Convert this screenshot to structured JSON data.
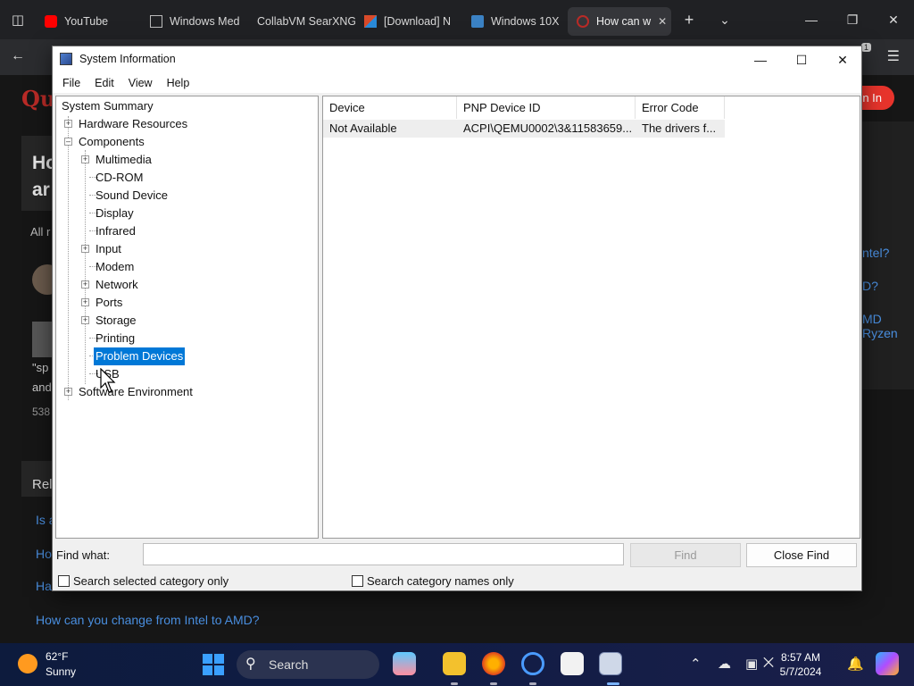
{
  "browser": {
    "tabs": [
      {
        "label": "YouTube",
        "icon": "youtube-icon",
        "color": "#ff0000"
      },
      {
        "label": "Windows Med",
        "icon": "windows-media-icon",
        "color": "#bbbbbb"
      },
      {
        "label": "CollabVM SearXNG",
        "icon": "searxng-icon",
        "color": "#3050ff"
      },
      {
        "label": "[Download] N",
        "icon": "download-icon",
        "color": "#d84a2a"
      },
      {
        "label": "Windows 10X",
        "icon": "windows-10x-icon",
        "color": "#3b82c4"
      },
      {
        "label": "How can w",
        "icon": "quora-icon",
        "color": "#b92b27"
      }
    ],
    "nav_badge": "1"
  },
  "webpage": {
    "logo": "Qu",
    "signin_label": "n In",
    "card_title_line1": "Ho",
    "card_title_line2": "ar",
    "all_text": "All r",
    "answer_line3": "\"sp",
    "answer_line4": "and",
    "views": "538",
    "related_label": "Rel",
    "related_links": [
      "Is a",
      "Ho",
      "How can you change from Intel to AMD?"
    ],
    "partial_related": "Ha",
    "side_links": [
      "ntel?",
      "D?",
      "MD Ryzen"
    ]
  },
  "window": {
    "title": "System Information",
    "menu": [
      "File",
      "Edit",
      "View",
      "Help"
    ],
    "tree": [
      {
        "label": "System Summary",
        "level": 0,
        "expander": ""
      },
      {
        "label": "Hardware Resources",
        "level": 1,
        "expander": "+"
      },
      {
        "label": "Components",
        "level": 1,
        "expander": "-"
      },
      {
        "label": "Multimedia",
        "level": 2,
        "expander": "+"
      },
      {
        "label": "CD-ROM",
        "level": 2,
        "expander": ""
      },
      {
        "label": "Sound Device",
        "level": 2,
        "expander": ""
      },
      {
        "label": "Display",
        "level": 2,
        "expander": ""
      },
      {
        "label": "Infrared",
        "level": 2,
        "expander": ""
      },
      {
        "label": "Input",
        "level": 2,
        "expander": "+"
      },
      {
        "label": "Modem",
        "level": 2,
        "expander": ""
      },
      {
        "label": "Network",
        "level": 2,
        "expander": "+"
      },
      {
        "label": "Ports",
        "level": 2,
        "expander": "+"
      },
      {
        "label": "Storage",
        "level": 2,
        "expander": "+"
      },
      {
        "label": "Printing",
        "level": 2,
        "expander": ""
      },
      {
        "label": "Problem Devices",
        "level": 2,
        "expander": "",
        "selected": true
      },
      {
        "label": "USB",
        "level": 2,
        "expander": ""
      },
      {
        "label": "Software Environment",
        "level": 1,
        "expander": "+"
      }
    ],
    "columns": [
      "Device",
      "PNP Device ID",
      "Error Code"
    ],
    "rows": [
      [
        "Not Available",
        "ACPI\\QEMU0002\\3&11583659...",
        "The drivers f..."
      ]
    ],
    "find_label": "Find what:",
    "find_value": "",
    "find_button": "Find",
    "close_find_button": "Close Find",
    "check_selected": "Search selected category only",
    "check_names": "Search category names only"
  },
  "taskbar": {
    "temperature": "62°F",
    "condition": "Sunny",
    "search_label": "Search",
    "time": "8:57 AM",
    "date": "5/7/2024"
  }
}
